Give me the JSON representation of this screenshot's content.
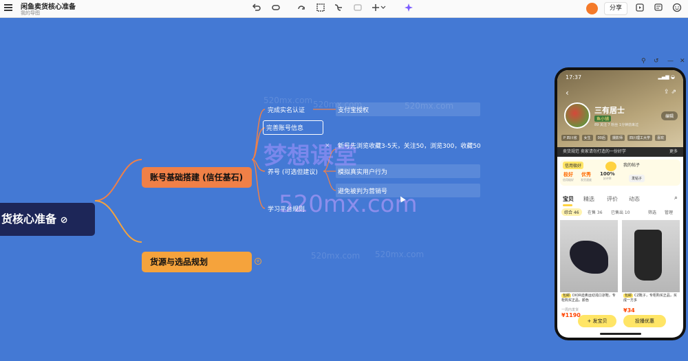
{
  "toolbar": {
    "doc_title": "闲鱼卖货核心准备",
    "doc_subtitle": "我的导图",
    "share_label": "分享",
    "tools": [
      "undo-icon",
      "redo-icon",
      "redo-icon",
      "frame-icon",
      "branch-icon",
      "note-icon",
      "insert-icon",
      "ai-icon"
    ],
    "accent": "#7b5cff"
  },
  "mindmap": {
    "root": "货核心准备",
    "branches": [
      {
        "label": "账号基础搭建 (信任基石)",
        "color": "#f08047",
        "leaves": [
          {
            "label": "完成实名认证",
            "child": "支付宝授权"
          },
          {
            "label": "完善账号信息"
          },
          {
            "label": "养号 (可选但建议)",
            "children": [
              "新号先浏览收藏3-5天，关注50，浏览300，收藏50",
              "模拟真实用户行为",
              "避免被判为营销号"
            ]
          },
          {
            "label": "学习平台规则"
          }
        ]
      },
      {
        "label": "货源与选品规划",
        "color": "#f5a33c",
        "leaves": []
      }
    ]
  },
  "watermarks": {
    "url": "520mx.com",
    "brand": "梦想课堂"
  },
  "phone": {
    "time": "17:37",
    "shop_name": "三有居士",
    "shop_badge": "鱼小铺",
    "shop_meta": "89 关注  7 粉丝  1分钟前来过",
    "edit_label": "编辑",
    "chips": [
      "P 四川省",
      "女生",
      "00后",
      "摄影师",
      "四川理工大学",
      "喜欢"
    ],
    "notice": "卖货规范  卖家请勿打造的一份好学",
    "notice_more": "更多",
    "stats_title": "信用极好",
    "stats": [
      {
        "value": "极好",
        "label": "信用极好"
      },
      {
        "value": "优秀",
        "label": "发货速度"
      },
      {
        "value": "100%",
        "label": "好评率"
      }
    ],
    "recent_label": "我的帖子",
    "recent_btn": "发帖子",
    "tabs": [
      "宝贝",
      "精选",
      "评价",
      "动态"
    ],
    "filters": [
      "综合 46",
      "在售 36",
      "已售出 10",
      "筛选",
      "管理"
    ],
    "products": [
      {
        "tag": "包邮",
        "desc": "DIOR迪奥运动浅口凉鞋，专柜购买正品，颜色",
        "price": "¥1190",
        "sold": "一周内发货"
      },
      {
        "tag": "包邮",
        "desc": "CZ靴子，专柜购买正品，买成一方多",
        "price": "¥34",
        "sold": ""
      }
    ],
    "publish_label": "+ 发宝贝",
    "coupon_label": "投播优惠"
  }
}
